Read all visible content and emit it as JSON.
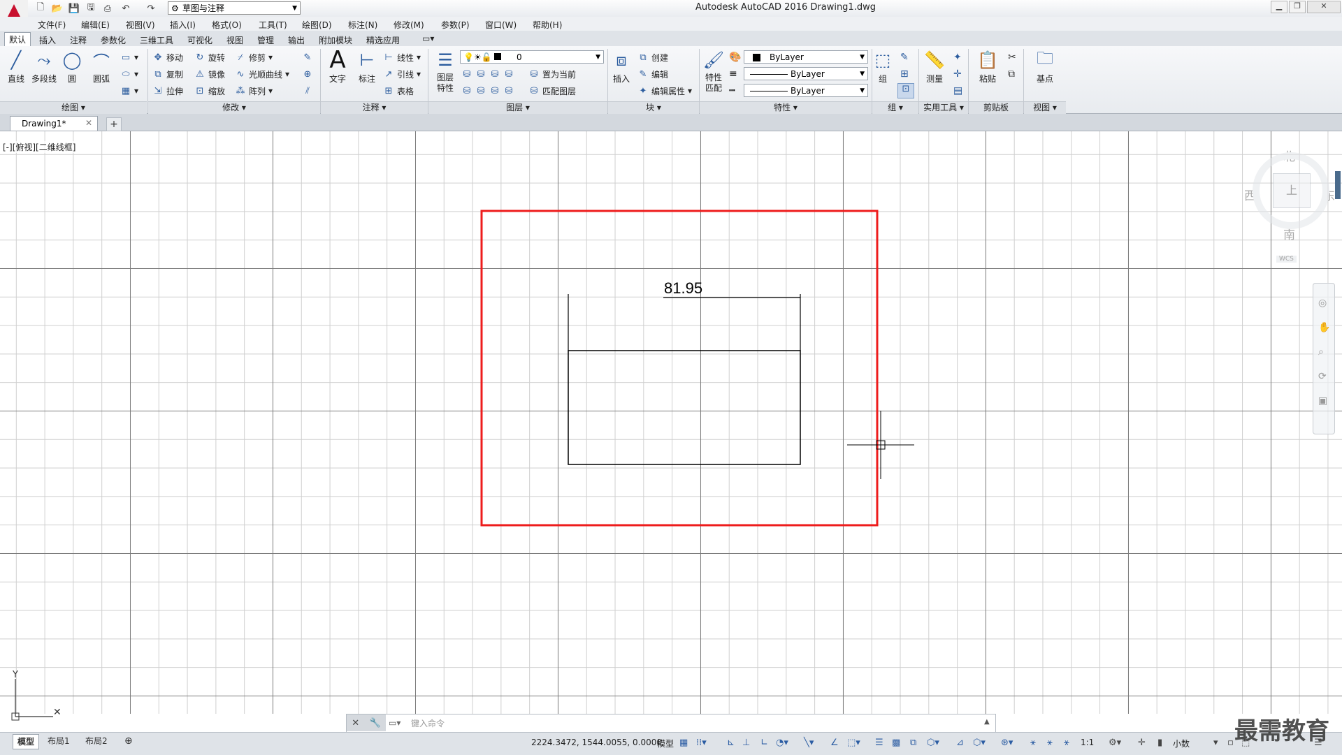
{
  "app": {
    "title": "Autodesk AutoCAD 2016    Drawing1.dwg",
    "workspace": "草图与注释"
  },
  "menu": [
    "文件(F)",
    "编辑(E)",
    "视图(V)",
    "插入(I)",
    "格式(O)",
    "工具(T)",
    "绘图(D)",
    "标注(N)",
    "修改(M)",
    "参数(P)",
    "窗口(W)",
    "帮助(H)"
  ],
  "ribbon_tabs": [
    "默认",
    "插入",
    "注释",
    "参数化",
    "三维工具",
    "可视化",
    "视图",
    "管理",
    "输出",
    "附加模块",
    "精选应用"
  ],
  "panels": {
    "draw": {
      "title": "绘图 ▾",
      "line": "直线",
      "polyline": "多段线",
      "circle": "圆",
      "arc": "圆弧"
    },
    "modify": {
      "title": "修改 ▾",
      "move": "移动",
      "rotate": "旋转",
      "trim": "修剪",
      "copy": "复制",
      "mirror": "镜像",
      "fillet": "光顺曲线",
      "stretch": "拉伸",
      "scale": "缩放",
      "array": "阵列"
    },
    "annotation": {
      "title": "注释 ▾",
      "text": "文字",
      "dimension": "标注",
      "linear": "线性",
      "leader": "引线",
      "table": "表格"
    },
    "layers": {
      "title": "图层 ▾",
      "layer_props": "图层\n特性",
      "current_layer": "0",
      "set_current": "置为当前",
      "match_layer": "匹配图层"
    },
    "block": {
      "title": "块 ▾",
      "insert": "插入",
      "create": "创建",
      "edit": "编辑",
      "edit_attr": "编辑属性"
    },
    "properties": {
      "title": "特性 ▾",
      "match": "特性\n匹配",
      "color": "ByLayer",
      "linetype": "ByLayer",
      "lineweight": "ByLayer"
    },
    "groups": {
      "title": "组 ▾",
      "group": "组"
    },
    "utilities": {
      "title": "实用工具 ▾",
      "measure": "测量"
    },
    "clipboard": {
      "title": "剪贴板",
      "paste": "粘贴"
    },
    "view": {
      "title": "视图 ▾",
      "base": "基点"
    }
  },
  "document_tab": "Drawing1*",
  "viewport_label": "[-][俯视][二维线框]",
  "viewcube": {
    "north": "北",
    "south": "南",
    "east": "东",
    "west": "西",
    "top": "上",
    "wcs": "WCS"
  },
  "drawing": {
    "dimension_text": "81.95"
  },
  "command_placeholder": "键入命令",
  "layout_tabs": [
    "模型",
    "布局1",
    "布局2"
  ],
  "status": {
    "coords": "2224.3472, 1544.0055, 0.0000",
    "model": "模型",
    "scale": "1:1",
    "units": "小数"
  },
  "watermark": "最需教育",
  "colors": {
    "highlight": "#ee1c1c",
    "accent": "#2b5c9e",
    "logo": "#c8102e"
  }
}
